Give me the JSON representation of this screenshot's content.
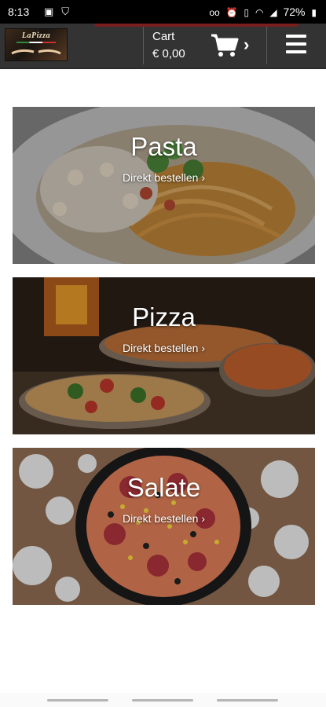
{
  "status_bar": {
    "time": "8:13",
    "battery": "72%"
  },
  "header": {
    "logo_text": "LaPizza",
    "cart_label": "Cart",
    "cart_total": "€ 0,00",
    "cart_chevron": "›"
  },
  "categories": [
    {
      "title": "Pasta",
      "link": "Direkt bestellen ›"
    },
    {
      "title": "Pizza",
      "link": "Direkt bestellen ›"
    },
    {
      "title": "Salate",
      "link": "Direkt bestellen ›"
    }
  ],
  "colors": {
    "header_bg": "#333333",
    "status_bar_bg": "#000000",
    "accent": "#7a1e1e",
    "text_on_dark": "#ffffff"
  },
  "icons": [
    "image-icon",
    "shield-icon",
    "voicemail-icon",
    "alarm-icon",
    "vibrate-icon",
    "wifi-icon",
    "signal-icon",
    "battery-icon",
    "cart-icon",
    "hamburger-menu-icon"
  ]
}
